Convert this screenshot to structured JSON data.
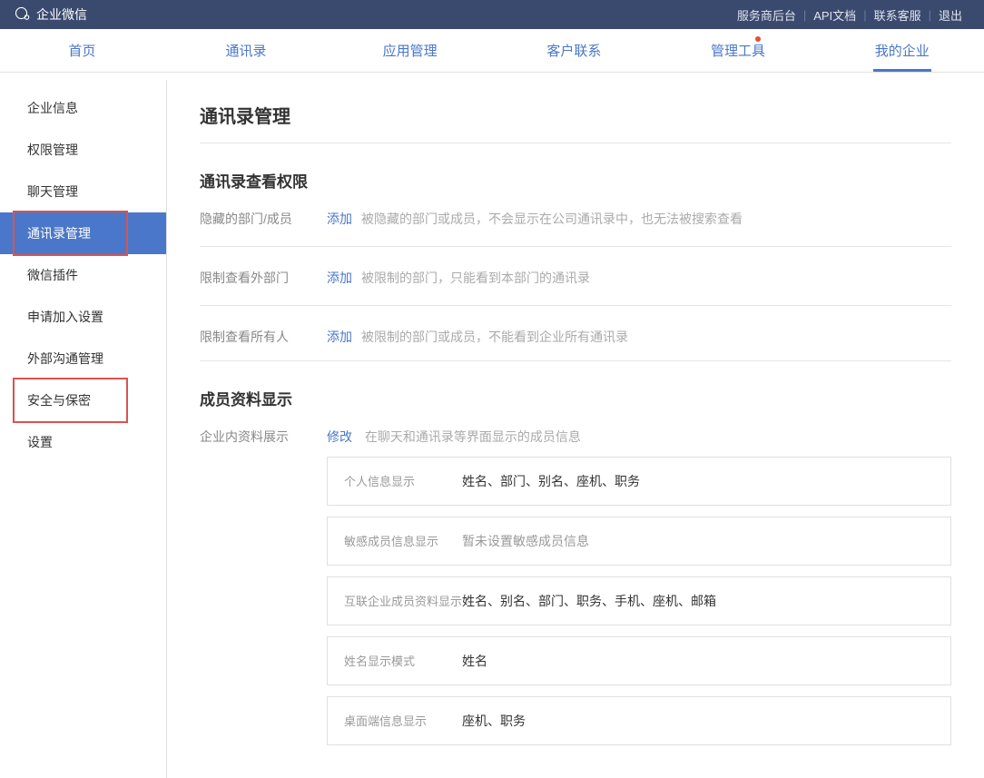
{
  "topbar": {
    "title": "企业微信",
    "links": [
      "服务商后台",
      "API文档",
      "联系客服",
      "退出"
    ]
  },
  "nav": {
    "items": [
      "首页",
      "通讯录",
      "应用管理",
      "客户联系",
      "管理工具",
      "我的企业"
    ],
    "active": 5,
    "dotIndex": 4
  },
  "sidebar": {
    "items": [
      "企业信息",
      "权限管理",
      "聊天管理",
      "通讯录管理",
      "微信插件",
      "申请加入设置",
      "外部沟通管理",
      "安全与保密",
      "设置"
    ],
    "active": 3,
    "highlights": [
      3,
      7
    ]
  },
  "content": {
    "title": "通讯录管理",
    "section1": {
      "title": "通讯录查看权限",
      "rows": [
        {
          "label": "隐藏的部门/成员",
          "action": "添加",
          "desc": "被隐藏的部门或成员，不会显示在公司通讯录中，也无法被搜索查看"
        },
        {
          "label": "限制查看外部门",
          "action": "添加",
          "desc": "被限制的部门，只能看到本部门的通讯录"
        },
        {
          "label": "限制查看所有人",
          "action": "添加",
          "desc": "被限制的部门或成员，不能看到企业所有通讯录"
        }
      ]
    },
    "section2": {
      "title": "成员资料显示",
      "headLabel": "企业内资料展示",
      "headAction": "修改",
      "headDesc": "在聊天和通讯录等界面显示的成员信息",
      "boxes": [
        {
          "label": "个人信息显示",
          "value": "姓名、部门、别名、座机、职务"
        },
        {
          "label": "敏感成员信息显示",
          "value": "暂未设置敏感成员信息"
        },
        {
          "label": "互联企业成员资料显示",
          "value": "姓名、别名、部门、职务、手机、座机、邮箱"
        },
        {
          "label": "姓名显示模式",
          "value": "姓名"
        },
        {
          "label": "桌面端信息显示",
          "value": "座机、职务"
        }
      ]
    }
  }
}
